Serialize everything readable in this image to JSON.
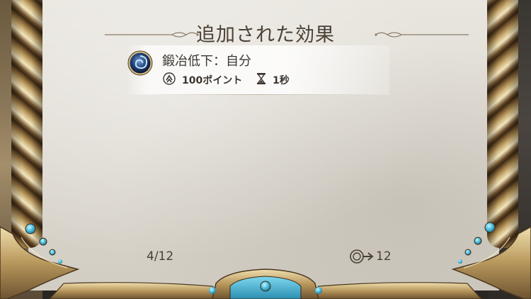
{
  "panel": {
    "title": "追加された効果"
  },
  "effect": {
    "name": "鍛冶低下：自分",
    "icon": "swirl-orb-icon",
    "cost_icon": "stamina-arrows-icon",
    "cost_text": "100ポイント",
    "duration_icon": "hourglass-icon",
    "duration_text": "1秒"
  },
  "footer": {
    "page": "4/12",
    "count_icon": "coin-arrow-icon",
    "count": "12"
  },
  "colors": {
    "parchment": "#e4e0d8",
    "text": "#3c3630",
    "gold": "#c9ad74",
    "gem": "#5ec8e6"
  }
}
